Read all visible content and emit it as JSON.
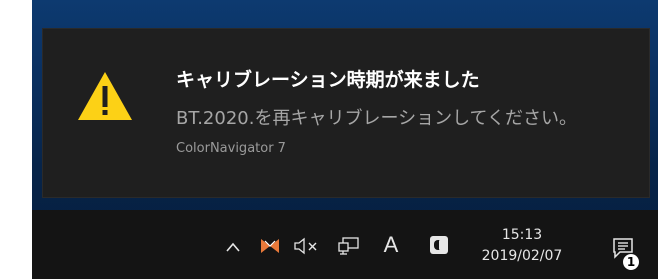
{
  "toast": {
    "title": "キャリブレーション時期が来ました",
    "body": "BT.2020.を再キャリブレーションしてください。",
    "app_name": "ColorNavigator 7",
    "icon": "warning-icon"
  },
  "taskbar": {
    "tray": {
      "chevron_icon": "show-hidden-icons",
      "app_icon": "colornavigator-tray-icon",
      "volume_icon": "volume-muted-icon",
      "network_icon": "network-icon",
      "ime_label": "A",
      "ime_icon": "ime-mode-icon"
    },
    "clock": {
      "time": "15:13",
      "date": "2019/02/07"
    },
    "action_center": {
      "icon": "action-center-icon",
      "badge_count": "1"
    }
  },
  "colors": {
    "toast_bg": "#1f1f1f",
    "taskbar_bg": "#141414",
    "warning_yellow": "#fcd116",
    "app_icon_orange": "#e8793a",
    "desktop_blue": "#0a2f5f"
  }
}
